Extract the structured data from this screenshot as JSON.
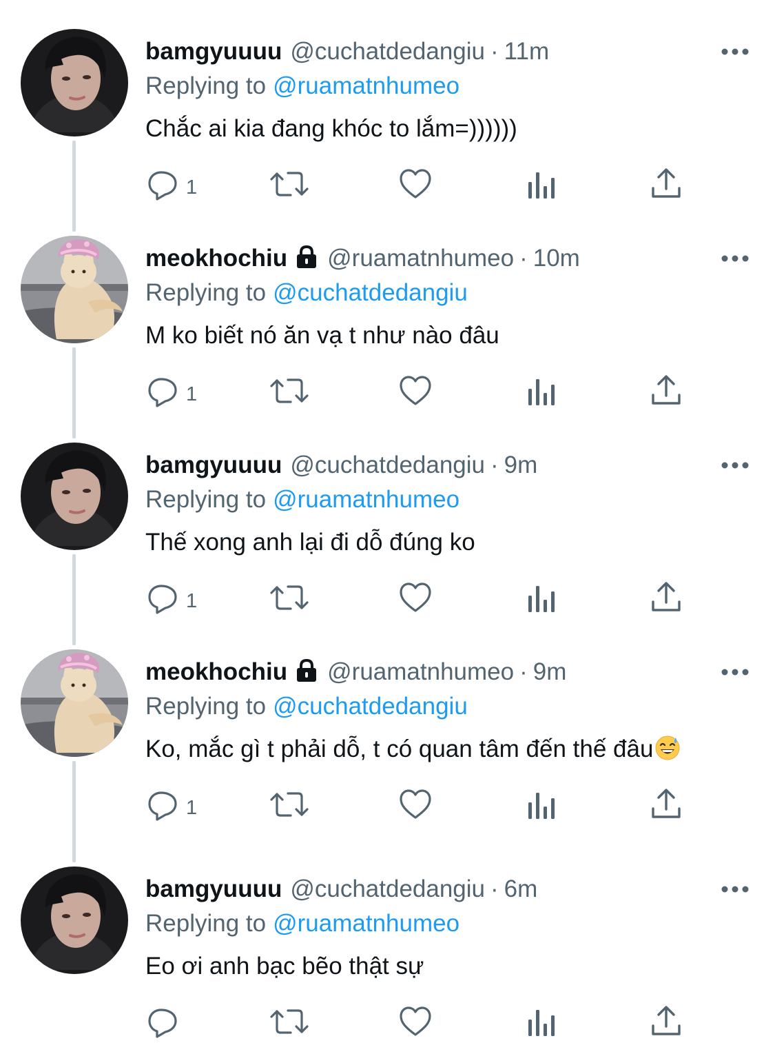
{
  "tweets": [
    {
      "name": "bamgyuuuu",
      "handle": "@cuchatdedangiu",
      "time": "11m",
      "separator": "·",
      "replying_label": "Replying to",
      "replying_to": "@ruamatnhumeo",
      "text": "Chắc ai kia đang khóc to lắm=))))))",
      "reply_count": "1",
      "avatar": "boy",
      "locked": false
    },
    {
      "name": "meokhochiu",
      "handle": "@ruamatnhumeo",
      "time": "10m",
      "separator": "·",
      "replying_label": "Replying to",
      "replying_to": "@cuchatdedangiu",
      "text": "M ko biết nó ăn vạ t như nào đâu",
      "reply_count": "1",
      "avatar": "cat",
      "locked": true
    },
    {
      "name": "bamgyuuuu",
      "handle": "@cuchatdedangiu",
      "time": "9m",
      "separator": "·",
      "replying_label": "Replying to",
      "replying_to": "@ruamatnhumeo",
      "text": "Thế xong anh lại đi dỗ đúng ko",
      "reply_count": "1",
      "avatar": "boy",
      "locked": false
    },
    {
      "name": "meokhochiu",
      "handle": "@ruamatnhumeo",
      "time": "9m",
      "separator": "·",
      "replying_label": "Replying to",
      "replying_to": "@cuchatdedangiu",
      "text": "Ko, mắc gì t phải dỗ, t có quan tâm đến thế đâu",
      "reply_count": "1",
      "avatar": "cat",
      "locked": true,
      "emoji": "grinning-sweat-emoji"
    },
    {
      "name": "bamgyuuuu",
      "handle": "@cuchatdedangiu",
      "time": "6m",
      "separator": "·",
      "replying_label": "Replying to",
      "replying_to": "@ruamatnhumeo",
      "text": "Eo ơi anh bạc bẽo thật sự",
      "reply_count": "",
      "avatar": "boy",
      "locked": false
    }
  ],
  "icons": {
    "reply": "reply-icon",
    "retweet": "retweet-icon",
    "like": "like-icon",
    "views": "views-icon",
    "share": "share-icon",
    "more": "more-options-icon",
    "lock": "lock-icon"
  },
  "colors": {
    "text": "#0f1419",
    "secondary": "#536471",
    "link": "#1d9bf0",
    "thread_line": "#cfd9de"
  }
}
